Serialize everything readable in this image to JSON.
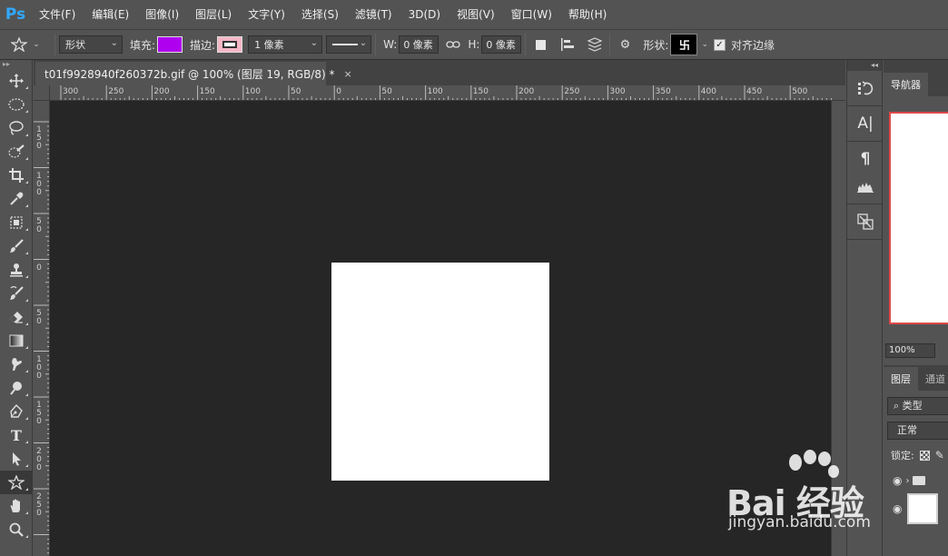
{
  "app": {
    "logo_text": "Ps",
    "menu": [
      "文件(F)",
      "编辑(E)",
      "图像(I)",
      "图层(L)",
      "文字(Y)",
      "选择(S)",
      "滤镜(T)",
      "3D(D)",
      "视图(V)",
      "窗口(W)",
      "帮助(H)"
    ]
  },
  "options_bar": {
    "tool_icon": "custom-shape-tool-icon",
    "mode_value": "形状",
    "fill_label": "填充:",
    "fill_color": "#b000f0",
    "stroke_label": "描边:",
    "stroke_color": "#f4b7c6",
    "stroke_width": "1 像素",
    "w_label": "W:",
    "w_value": "0 像素",
    "h_label": "H:",
    "h_value": "0 像素",
    "shape_label": "形状:",
    "shape_preview": "卐",
    "align_edges_label": "对齐边缘",
    "align_edges_checked": true
  },
  "document": {
    "tab_title": "t01f9928940f260372b.gif @ 100% (图层 19, RGB/8) *",
    "close_glyph": "×",
    "canvas_color": "#ffffff"
  },
  "ruler": {
    "top_labels": [
      "300",
      "250",
      "200",
      "150",
      "100",
      "50",
      "0",
      "50",
      "100",
      "150",
      "200",
      "250",
      "300",
      "350",
      "400",
      "450",
      "500"
    ],
    "left_labels": [
      "1\n5\n0",
      "1\n0\n0",
      "5\n0",
      "0",
      "5\n0",
      "1\n0\n0",
      "1\n5\n0",
      "2\n0\n0",
      "2\n5\n0"
    ]
  },
  "tools": [
    "move",
    "marquee",
    "lasso",
    "quick-select",
    "crop",
    "eyedropper",
    "patch",
    "brush",
    "stamp",
    "history-brush",
    "eraser",
    "gradient",
    "smudge",
    "dodge",
    "pen",
    "type",
    "path-select",
    "custom-shape",
    "hand",
    "zoom"
  ],
  "panel_strip": [
    "history",
    "character",
    "paragraph",
    "histogram",
    "info"
  ],
  "navigator": {
    "tab_label": "导航器",
    "zoom": "100%"
  },
  "layers": {
    "tab_label": "图层",
    "tab2_label": "通道",
    "filter_label": "类型",
    "blend_mode": "正常",
    "lock_label": "锁定:"
  },
  "watermark": {
    "main": "Bai 经验",
    "sub": "jingyan.baidu.com"
  }
}
